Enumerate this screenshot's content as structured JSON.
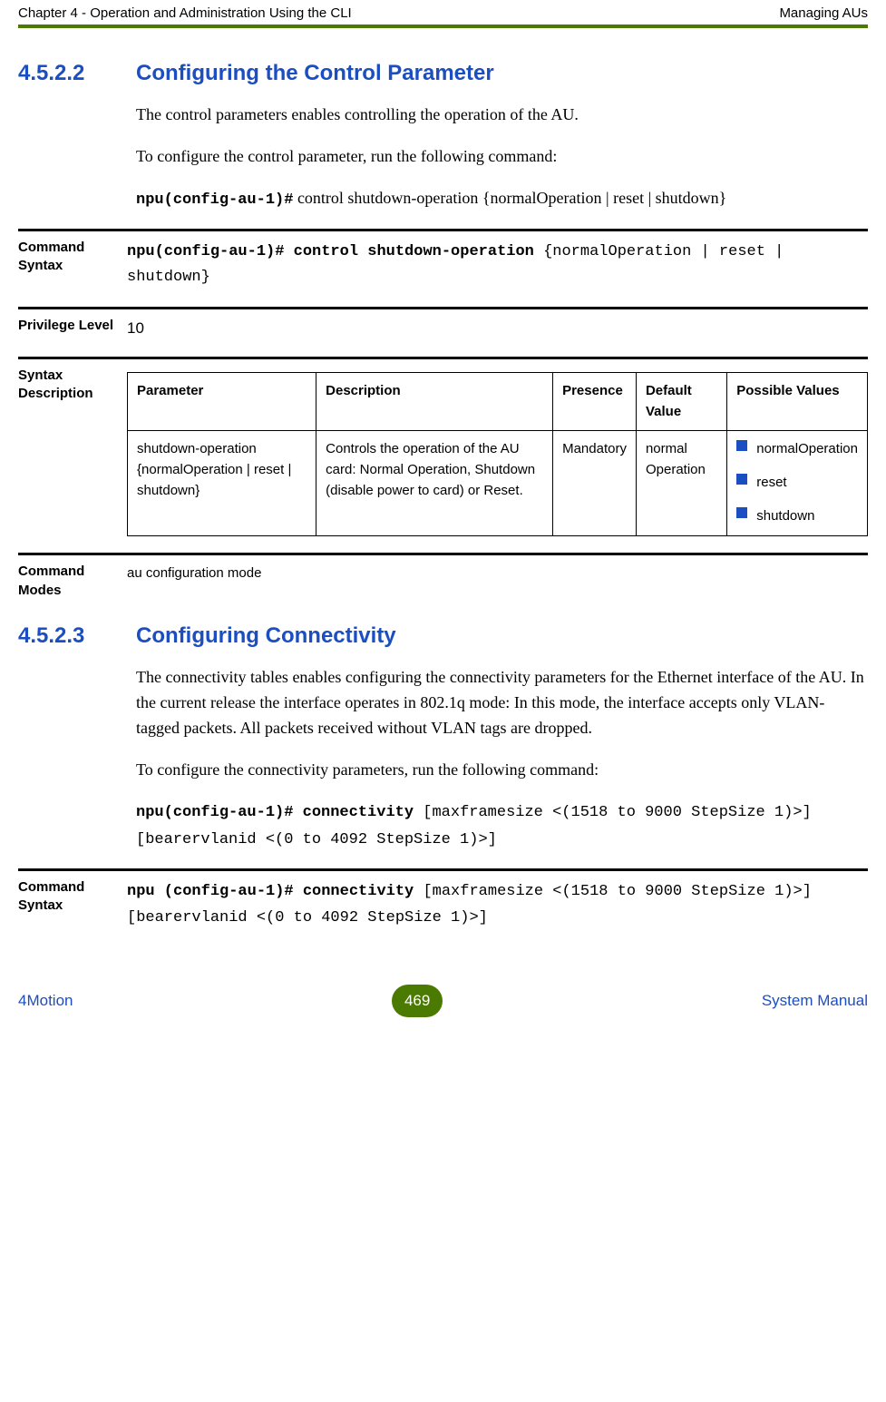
{
  "header": {
    "left": "Chapter 4 - Operation and Administration Using the CLI",
    "right": "Managing AUs"
  },
  "section1": {
    "number": "4.5.2.2",
    "title": "Configuring the Control Parameter",
    "para1": "The control parameters enables controlling the operation of the AU.",
    "para2": "To configure the control parameter, run the following command:",
    "cmd_prefix": "npu(config-au-1)#",
    "cmd_rest": " control shutdown-operation {normalOperation | reset | shutdown}"
  },
  "def1": {
    "label": "Command Syntax",
    "value_bold": "npu(config-au-1)# control shutdown-operation ",
    "value_rest": "{normalOperation | reset | shutdown}"
  },
  "def2": {
    "label": "Privilege Level",
    "value": "10"
  },
  "syntax": {
    "label": "Syntax Description",
    "headers": {
      "h1": "Parameter",
      "h2": "Description",
      "h3": "Presence",
      "h4": "Default Value",
      "h5": "Possible Values"
    },
    "row": {
      "parameter": "shutdown-operation {normalOperation | reset | shutdown}",
      "description": "Controls the operation of the AU card: Normal Operation, Shutdown (disable power to card) or Reset.",
      "presence": "Mandatory",
      "default": "normal Operation",
      "pv1": "normalOperation",
      "pv2": "reset",
      "pv3": "shutdown"
    }
  },
  "def3": {
    "label": "Command Modes",
    "value": "au configuration mode"
  },
  "section2": {
    "number": "4.5.2.3",
    "title": "Configuring Connectivity",
    "para1": "The connectivity tables enables configuring the connectivity parameters for the Ethernet interface of the AU. In the current release the interface operates in 802.1q mode: In this mode, the interface accepts only VLAN-tagged packets. All packets received without VLAN tags are dropped.",
    "para2": "To configure the connectivity parameters, run the following command:",
    "cmd_bold": "npu(config-au-1)# connectivity ",
    "cmd_rest": "[maxframesize <(1518 to 9000 StepSize 1)>] [bearervlanid <(0 to 4092 StepSize 1)>]"
  },
  "def4": {
    "label": "Command Syntax",
    "value_bold": "npu (config-au-1)# connectivity ",
    "value_rest": "[maxframesize <(1518 to 9000 StepSize 1)>] [bearervlanid <(0 to 4092 StepSize 1)>]"
  },
  "footer": {
    "left": "4Motion",
    "page": "469",
    "right": "System Manual"
  }
}
